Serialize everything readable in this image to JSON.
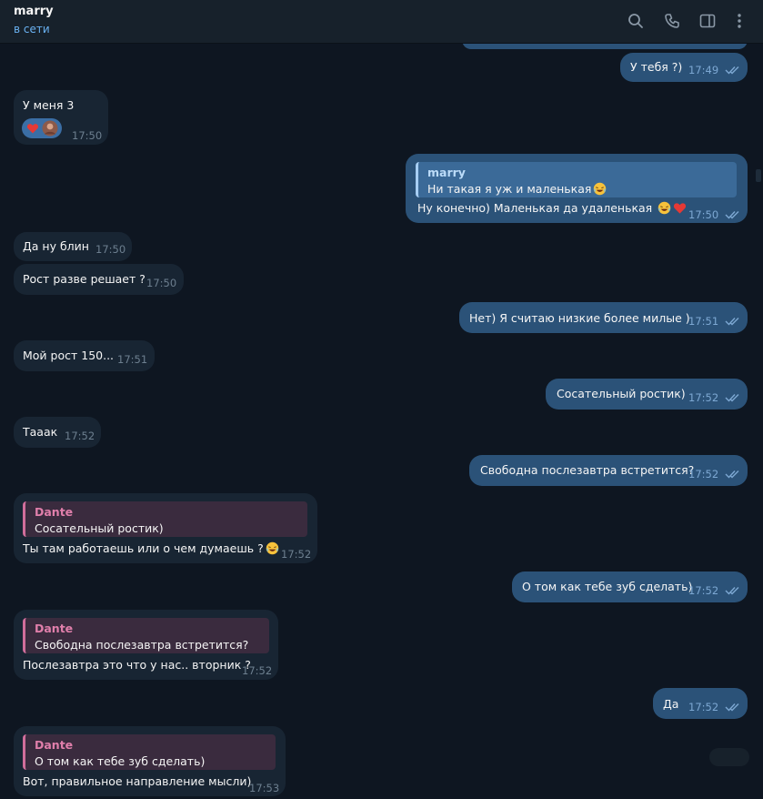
{
  "header": {
    "name": "marry",
    "status": "в сети",
    "icons": [
      "search-icon",
      "phone-icon",
      "sidebar-toggle-icon",
      "more-vertical-icon"
    ]
  },
  "colors": {
    "background": "#0e1621",
    "incoming_bubble": "#182533",
    "outgoing_bubble": "#2b5278",
    "accent": "#6ab2f2",
    "quote_pink": "#d06e9b"
  },
  "messages": [
    {
      "dir": "out",
      "text": "У тебя ?)",
      "time": "17:49"
    },
    {
      "dir": "in",
      "text": "У меня 3",
      "time": "17:50",
      "reactions": [
        "heart-icon",
        "avatar"
      ]
    },
    {
      "dir": "out",
      "reply_name": "marry",
      "reply_text": "Ни такая я уж и маленькая",
      "text": "Ну конечно) Маленькая да удаленькая",
      "time": "17:50"
    },
    {
      "dir": "in",
      "text": "Да ну блин",
      "time": "17:50"
    },
    {
      "dir": "in",
      "text": "Рост разве решает ?",
      "time": "17:50"
    },
    {
      "dir": "out",
      "text": "Нет) Я считаю низкие более милые  )",
      "time": "17:51"
    },
    {
      "dir": "in",
      "text": "Мой рост 150...",
      "time": "17:51"
    },
    {
      "dir": "out",
      "text": "Сосательный ростик)",
      "time": "17:52"
    },
    {
      "dir": "in",
      "text": "Тааак",
      "time": "17:52"
    },
    {
      "dir": "out",
      "text": "Свободна послезавтра встретится?",
      "time": "17:52"
    },
    {
      "dir": "in",
      "reply_name": "Dante",
      "reply_text": "Сосательный ростик)",
      "text": "Ты там работаешь или о чем думаешь ?",
      "time": "17:52"
    },
    {
      "dir": "out",
      "text": "О том как тебе зуб сделать)",
      "time": "17:52"
    },
    {
      "dir": "in",
      "reply_name": "Dante",
      "reply_text": "Свободна послезавтра встретится?",
      "text": "Послезавтра это что у нас.. вторник ?",
      "time": "17:52"
    },
    {
      "dir": "out",
      "text": "Да",
      "time": "17:52"
    },
    {
      "dir": "in",
      "reply_name": "Dante",
      "reply_text": "О том как тебе зуб сделать)",
      "text": "Вот, правильное направление мысли)",
      "time": "17:53"
    }
  ]
}
